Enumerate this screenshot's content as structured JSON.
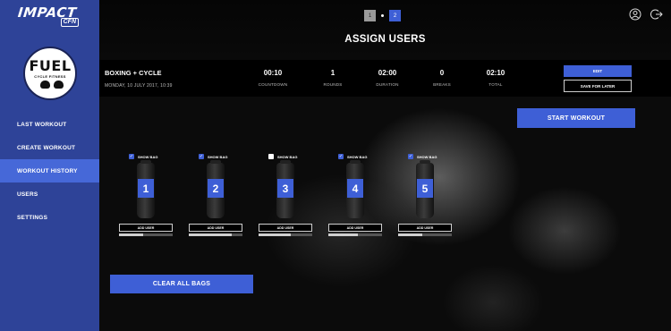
{
  "brand": {
    "name": "IMPACT",
    "sub": "CFN"
  },
  "club_logo": {
    "name": "FUEL",
    "sub": "CYCLE FITNESS"
  },
  "sidebar": {
    "items": [
      {
        "label": "LAST WORKOUT"
      },
      {
        "label": "CREATE WORKOUT"
      },
      {
        "label": "WORKOUT HISTORY",
        "active": true
      },
      {
        "label": "USERS"
      },
      {
        "label": "SETTINGS"
      }
    ]
  },
  "stepper": {
    "steps": [
      "1",
      "2"
    ],
    "current": 2
  },
  "header": {
    "icons": [
      "account-icon",
      "logout-icon"
    ]
  },
  "page_title": "ASSIGN USERS",
  "workout": {
    "name": "BOXING + CYCLE",
    "date": "MONDAY, 10 JULY 2017, 10:39",
    "stats": [
      {
        "value": "00:10",
        "label": "COUNTDOWN"
      },
      {
        "value": "1",
        "label": "ROUNDS"
      },
      {
        "value": "02:00",
        "label": "DURATION"
      },
      {
        "value": "0",
        "label": "BREAKS"
      },
      {
        "value": "02:10",
        "label": "TOTAL"
      }
    ],
    "edit_label": "EDIT",
    "save_label": "SAVE FOR LATER"
  },
  "start_label": "START WORKOUT",
  "bags": [
    {
      "number": "1",
      "show": true,
      "show_label": "SHOW BAG",
      "add_label": "ADD USER",
      "level": 0.45
    },
    {
      "number": "2",
      "show": true,
      "show_label": "SHOW BAG",
      "add_label": "ADD USER",
      "level": 0.8
    },
    {
      "number": "3",
      "show": false,
      "show_label": "SHOW BAG",
      "add_label": "ADD USER",
      "level": 0.6
    },
    {
      "number": "4",
      "show": true,
      "show_label": "SHOW BAG",
      "add_label": "ADD USER",
      "level": 0.55
    },
    {
      "number": "5",
      "show": true,
      "show_label": "SHOW BAG",
      "add_label": "ADD USER",
      "level": 0.45
    }
  ],
  "clear_label": "CLEAR ALL BAGS",
  "colors": {
    "sidebar": "#2e4398",
    "accent": "#3e5fd6",
    "active_nav": "#4668d8"
  }
}
